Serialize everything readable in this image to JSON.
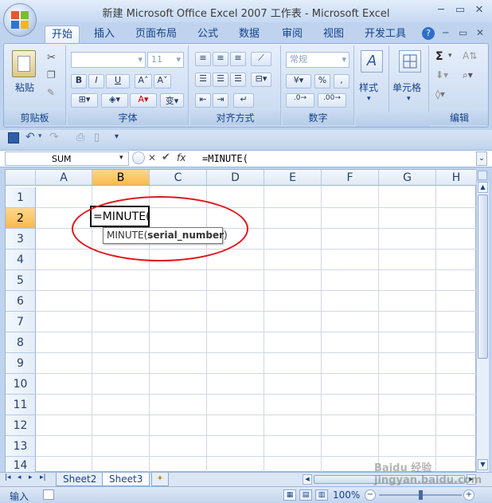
{
  "title": "新建 Microsoft Office Excel 2007 工作表 - Microsoft Excel",
  "tabs": [
    "开始",
    "插入",
    "页面布局",
    "公式",
    "数据",
    "审阅",
    "视图",
    "开发工具"
  ],
  "active_tab": "开始",
  "ribbon": {
    "clipboard": {
      "paste": "粘贴",
      "label": "剪贴板"
    },
    "font": {
      "size": "11",
      "label": "字体",
      "bold": "B",
      "italic": "I",
      "underline": "U"
    },
    "align": {
      "label": "对齐方式"
    },
    "number": {
      "format": "常规",
      "label": "数字",
      "percent": "%",
      "comma": ","
    },
    "styles": {
      "label": "样式"
    },
    "cells": {
      "label": "单元格"
    },
    "editing": {
      "label": "编辑",
      "sigma": "Σ"
    }
  },
  "formula_bar": {
    "name_box": "SUM",
    "fx": "fx",
    "formula": "=MINUTE("
  },
  "columns": [
    "A",
    "B",
    "C",
    "D",
    "E",
    "F",
    "G",
    "H"
  ],
  "selected_column": "B",
  "rows": [
    "1",
    "2",
    "3",
    "4",
    "5",
    "6",
    "7",
    "8",
    "9",
    "10",
    "11",
    "12",
    "13",
    "14"
  ],
  "selected_row": "2",
  "active_cell": {
    "text": "=MINUTE("
  },
  "tooltip": {
    "prefix": "MINUTE(",
    "arg": "serial_number",
    "suffix": ")"
  },
  "sheets": [
    "Sheet2",
    "Sheet3"
  ],
  "active_sheet": "Sheet3",
  "status": {
    "mode": "输入",
    "zoom": "100%"
  },
  "watermark": "Baidu 经验 jingyan.baidu.com",
  "colors": {
    "ribbon": "#d3e1f4",
    "selection": "#f9b94a",
    "annotation": "#e0141b"
  }
}
